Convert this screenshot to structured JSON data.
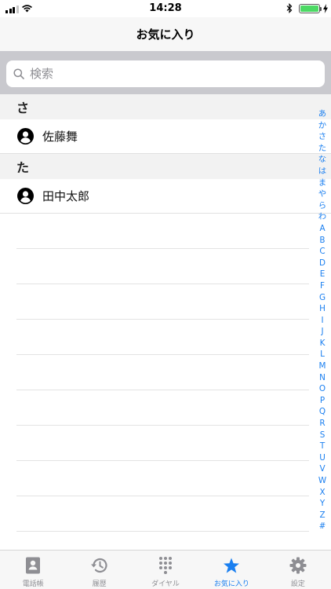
{
  "status_bar": {
    "time": "14:28"
  },
  "nav": {
    "title": "お気に入り"
  },
  "search": {
    "placeholder": "検索"
  },
  "sections": [
    {
      "header": "さ",
      "contacts": [
        "佐藤舞"
      ]
    },
    {
      "header": "た",
      "contacts": [
        "田中太郎"
      ]
    }
  ],
  "index": [
    "あ",
    "か",
    "さ",
    "た",
    "な",
    "は",
    "ま",
    "や",
    "ら",
    "わ",
    "A",
    "B",
    "C",
    "D",
    "E",
    "F",
    "G",
    "H",
    "I",
    "J",
    "K",
    "L",
    "M",
    "N",
    "O",
    "P",
    "Q",
    "R",
    "S",
    "T",
    "U",
    "V",
    "W",
    "X",
    "Y",
    "Z",
    "#"
  ],
  "tabs": [
    {
      "label": "電話帳",
      "icon": "contacts-book-icon",
      "active": false
    },
    {
      "label": "履歴",
      "icon": "history-icon",
      "active": false
    },
    {
      "label": "ダイヤル",
      "icon": "keypad-icon",
      "active": false
    },
    {
      "label": "お気に入り",
      "icon": "star-icon",
      "active": true
    },
    {
      "label": "設定",
      "icon": "gear-icon",
      "active": false
    }
  ],
  "colors": {
    "accent": "#1a7ff0",
    "inactive": "#8e8e93",
    "battery": "#4cd964"
  }
}
